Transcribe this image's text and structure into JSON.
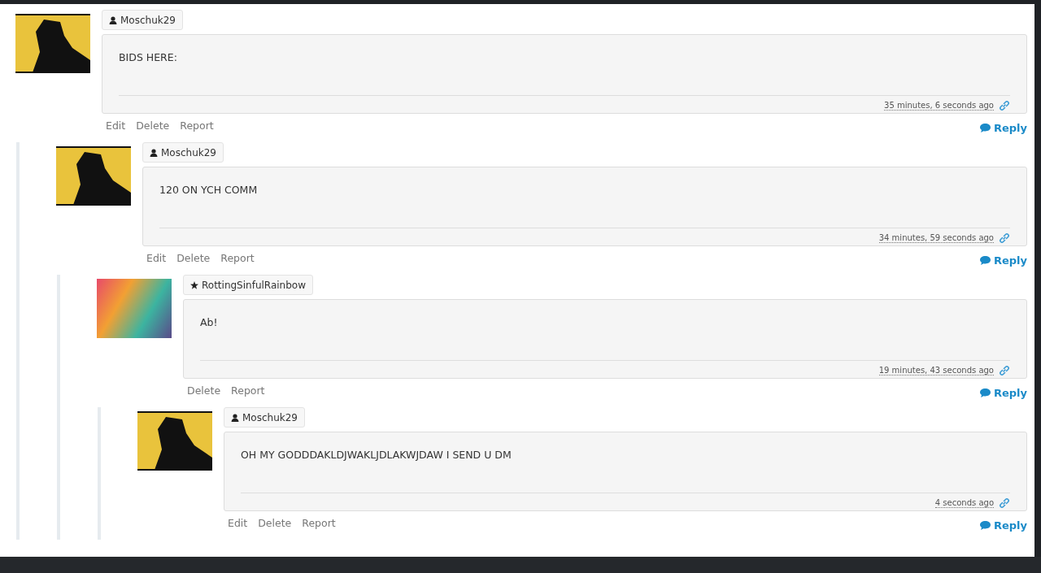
{
  "comments": [
    {
      "author": "Moschuk29",
      "kind": "user",
      "text": "BIDS HERE:",
      "time": "35 minutes, 6 seconds ago",
      "actions": [
        "Edit",
        "Delete",
        "Report"
      ],
      "reply": "Reply",
      "children": [
        {
          "author": "Moschuk29",
          "kind": "user",
          "text": "120 ON YCH COMM",
          "time": "34 minutes, 59 seconds ago",
          "actions": [
            "Edit",
            "Delete",
            "Report"
          ],
          "reply": "Reply",
          "children": [
            {
              "author": "RottingSinfulRainbow",
              "kind": "star",
              "text": "Ab!",
              "time": "19 minutes, 43 seconds ago",
              "actions": [
                "Delete",
                "Report"
              ],
              "reply": "Reply",
              "children": [
                {
                  "author": "Moschuk29",
                  "kind": "user",
                  "text": "OH MY GODDDAKLDJWAKLJDLAKWJDAW I SEND U DM",
                  "time": "4 seconds ago",
                  "actions": [
                    "Edit",
                    "Delete",
                    "Report"
                  ],
                  "reply": "Reply"
                }
              ]
            }
          ]
        }
      ]
    }
  ]
}
